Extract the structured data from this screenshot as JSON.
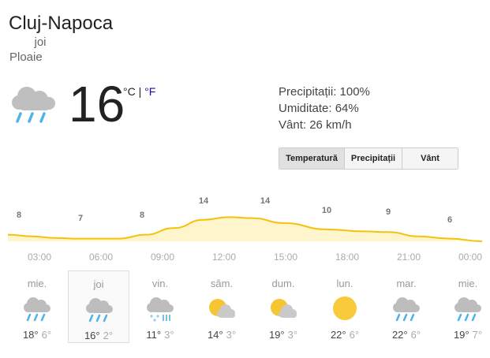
{
  "location": "Cluj-Napoca",
  "day": "joi",
  "condition": "Ploaie",
  "current": {
    "temp": "16",
    "unit_c": "°C",
    "separator": " | ",
    "unit_f": "°F",
    "icon": "cloud-rain-icon"
  },
  "details": {
    "precip": "Precipitații: 100%",
    "humidity": "Umiditate: 64%",
    "wind": "Vânt: 26 km/h"
  },
  "tabs": [
    "Temperatură",
    "Precipitații",
    "Vânt"
  ],
  "chart_data": {
    "type": "area",
    "x": [
      "03:00",
      "06:00",
      "09:00",
      "12:00",
      "15:00",
      "18:00",
      "21:00",
      "00:00"
    ],
    "labels_shown": [
      "8",
      "7",
      "8",
      "14",
      "14",
      "10",
      "9",
      "6"
    ],
    "values": [
      8,
      7,
      8,
      14,
      14,
      10,
      9,
      6
    ],
    "color": "#f4c20d",
    "fill": "#fff5cc"
  },
  "forecast": [
    {
      "name": "mie.",
      "hi": "18°",
      "lo": "6°",
      "icon": "cloud-rain-icon"
    },
    {
      "name": "joi",
      "hi": "16°",
      "lo": "2°",
      "icon": "cloud-rain-icon"
    },
    {
      "name": "vin.",
      "hi": "11°",
      "lo": "3°",
      "icon": "snow-rain-icon"
    },
    {
      "name": "sâm.",
      "hi": "14°",
      "lo": "3°",
      "icon": "partly-cloudy-icon"
    },
    {
      "name": "dum.",
      "hi": "19°",
      "lo": "3°",
      "icon": "partly-cloudy-icon"
    },
    {
      "name": "lun.",
      "hi": "22°",
      "lo": "6°",
      "icon": "sun-icon"
    },
    {
      "name": "mar.",
      "hi": "22°",
      "lo": "6°",
      "icon": "cloud-rain-icon"
    },
    {
      "name": "mie.",
      "hi": "19°",
      "lo": "7°",
      "icon": "cloud-rain-icon"
    }
  ]
}
